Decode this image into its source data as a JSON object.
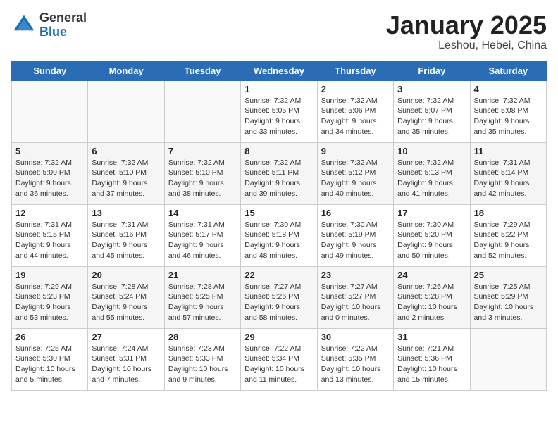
{
  "header": {
    "logo_general": "General",
    "logo_blue": "Blue",
    "title": "January 2025",
    "subtitle": "Leshou, Hebei, China"
  },
  "weekdays": [
    "Sunday",
    "Monday",
    "Tuesday",
    "Wednesday",
    "Thursday",
    "Friday",
    "Saturday"
  ],
  "weeks": [
    [
      {
        "day": "",
        "info": ""
      },
      {
        "day": "",
        "info": ""
      },
      {
        "day": "",
        "info": ""
      },
      {
        "day": "1",
        "info": "Sunrise: 7:32 AM\nSunset: 5:05 PM\nDaylight: 9 hours\nand 33 minutes."
      },
      {
        "day": "2",
        "info": "Sunrise: 7:32 AM\nSunset: 5:06 PM\nDaylight: 9 hours\nand 34 minutes."
      },
      {
        "day": "3",
        "info": "Sunrise: 7:32 AM\nSunset: 5:07 PM\nDaylight: 9 hours\nand 35 minutes."
      },
      {
        "day": "4",
        "info": "Sunrise: 7:32 AM\nSunset: 5:08 PM\nDaylight: 9 hours\nand 35 minutes."
      }
    ],
    [
      {
        "day": "5",
        "info": "Sunrise: 7:32 AM\nSunset: 5:09 PM\nDaylight: 9 hours\nand 36 minutes."
      },
      {
        "day": "6",
        "info": "Sunrise: 7:32 AM\nSunset: 5:10 PM\nDaylight: 9 hours\nand 37 minutes."
      },
      {
        "day": "7",
        "info": "Sunrise: 7:32 AM\nSunset: 5:10 PM\nDaylight: 9 hours\nand 38 minutes."
      },
      {
        "day": "8",
        "info": "Sunrise: 7:32 AM\nSunset: 5:11 PM\nDaylight: 9 hours\nand 39 minutes."
      },
      {
        "day": "9",
        "info": "Sunrise: 7:32 AM\nSunset: 5:12 PM\nDaylight: 9 hours\nand 40 minutes."
      },
      {
        "day": "10",
        "info": "Sunrise: 7:32 AM\nSunset: 5:13 PM\nDaylight: 9 hours\nand 41 minutes."
      },
      {
        "day": "11",
        "info": "Sunrise: 7:31 AM\nSunset: 5:14 PM\nDaylight: 9 hours\nand 42 minutes."
      }
    ],
    [
      {
        "day": "12",
        "info": "Sunrise: 7:31 AM\nSunset: 5:15 PM\nDaylight: 9 hours\nand 44 minutes."
      },
      {
        "day": "13",
        "info": "Sunrise: 7:31 AM\nSunset: 5:16 PM\nDaylight: 9 hours\nand 45 minutes."
      },
      {
        "day": "14",
        "info": "Sunrise: 7:31 AM\nSunset: 5:17 PM\nDaylight: 9 hours\nand 46 minutes."
      },
      {
        "day": "15",
        "info": "Sunrise: 7:30 AM\nSunset: 5:18 PM\nDaylight: 9 hours\nand 48 minutes."
      },
      {
        "day": "16",
        "info": "Sunrise: 7:30 AM\nSunset: 5:19 PM\nDaylight: 9 hours\nand 49 minutes."
      },
      {
        "day": "17",
        "info": "Sunrise: 7:30 AM\nSunset: 5:20 PM\nDaylight: 9 hours\nand 50 minutes."
      },
      {
        "day": "18",
        "info": "Sunrise: 7:29 AM\nSunset: 5:22 PM\nDaylight: 9 hours\nand 52 minutes."
      }
    ],
    [
      {
        "day": "19",
        "info": "Sunrise: 7:29 AM\nSunset: 5:23 PM\nDaylight: 9 hours\nand 53 minutes."
      },
      {
        "day": "20",
        "info": "Sunrise: 7:28 AM\nSunset: 5:24 PM\nDaylight: 9 hours\nand 55 minutes."
      },
      {
        "day": "21",
        "info": "Sunrise: 7:28 AM\nSunset: 5:25 PM\nDaylight: 9 hours\nand 57 minutes."
      },
      {
        "day": "22",
        "info": "Sunrise: 7:27 AM\nSunset: 5:26 PM\nDaylight: 9 hours\nand 58 minutes."
      },
      {
        "day": "23",
        "info": "Sunrise: 7:27 AM\nSunset: 5:27 PM\nDaylight: 10 hours\nand 0 minutes."
      },
      {
        "day": "24",
        "info": "Sunrise: 7:26 AM\nSunset: 5:28 PM\nDaylight: 10 hours\nand 2 minutes."
      },
      {
        "day": "25",
        "info": "Sunrise: 7:25 AM\nSunset: 5:29 PM\nDaylight: 10 hours\nand 3 minutes."
      }
    ],
    [
      {
        "day": "26",
        "info": "Sunrise: 7:25 AM\nSunset: 5:30 PM\nDaylight: 10 hours\nand 5 minutes."
      },
      {
        "day": "27",
        "info": "Sunrise: 7:24 AM\nSunset: 5:31 PM\nDaylight: 10 hours\nand 7 minutes."
      },
      {
        "day": "28",
        "info": "Sunrise: 7:23 AM\nSunset: 5:33 PM\nDaylight: 10 hours\nand 9 minutes."
      },
      {
        "day": "29",
        "info": "Sunrise: 7:22 AM\nSunset: 5:34 PM\nDaylight: 10 hours\nand 11 minutes."
      },
      {
        "day": "30",
        "info": "Sunrise: 7:22 AM\nSunset: 5:35 PM\nDaylight: 10 hours\nand 13 minutes."
      },
      {
        "day": "31",
        "info": "Sunrise: 7:21 AM\nSunset: 5:36 PM\nDaylight: 10 hours\nand 15 minutes."
      },
      {
        "day": "",
        "info": ""
      }
    ]
  ]
}
